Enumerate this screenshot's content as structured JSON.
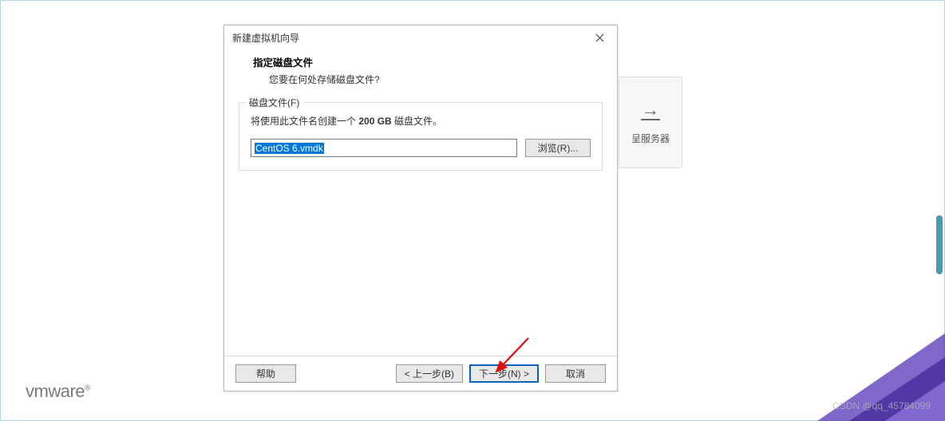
{
  "dialog": {
    "title": "新建虚拟机向导",
    "heading": "指定磁盘文件",
    "subheading": "您要在何处存储磁盘文件?",
    "group": {
      "legend": "磁盘文件(F)",
      "desc_prefix": "将使用此文件名创建一个 ",
      "desc_size": "200 GB",
      "desc_suffix": " 磁盘文件。",
      "filename": "CentOS 6.vmdk",
      "browse": "浏览(R)..."
    },
    "buttons": {
      "help": "帮助",
      "back": "< 上一步(B)",
      "next": "下一步(N) >",
      "cancel": "取消"
    }
  },
  "background_card": {
    "label": "呈服务器"
  },
  "logo": {
    "text": "vmware",
    "reg": "®"
  },
  "watermark": "CSDN @qq_45784099"
}
